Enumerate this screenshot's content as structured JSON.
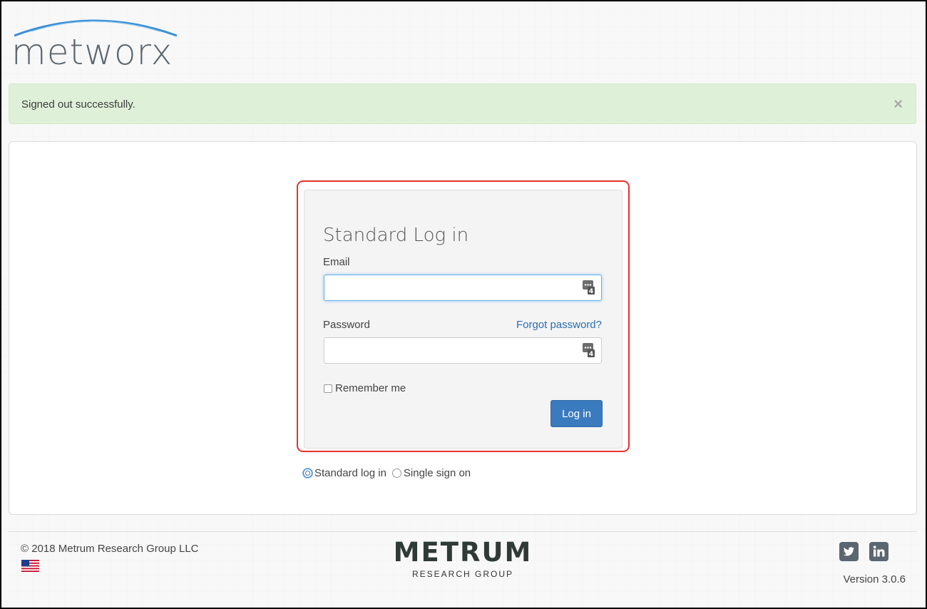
{
  "brand": {
    "logo_text": "metworx"
  },
  "alert": {
    "message": "Signed out successfully.",
    "close_symbol": "×"
  },
  "login": {
    "title": "Standard Log in",
    "email_label": "Email",
    "email_value": "",
    "password_label": "Password",
    "password_value": "",
    "forgot_link": "Forgot password?",
    "remember_label": "Remember me",
    "remember_checked": false,
    "submit_label": "Log in",
    "field_icon": "password-manager-icon"
  },
  "login_mode": {
    "options": [
      {
        "label": "Standard log in",
        "selected": true
      },
      {
        "label": "Single sign on",
        "selected": false
      }
    ]
  },
  "footer": {
    "copyright": "© 2018 Metrum Research Group LLC",
    "company_name": "METRUM",
    "company_sub": "RESEARCH GROUP",
    "version": "Version 3.0.6",
    "social_icons": [
      "twitter-icon",
      "linkedin-icon"
    ],
    "locale_icon": "us-flag-icon"
  },
  "colors": {
    "alert_bg": "#dff0d8",
    "primary": "#3a7bc0",
    "link": "#2a6fb1",
    "highlight": "#e8322b",
    "logo_arc": "#3a8fd6",
    "logo_text": "#5b6670"
  }
}
